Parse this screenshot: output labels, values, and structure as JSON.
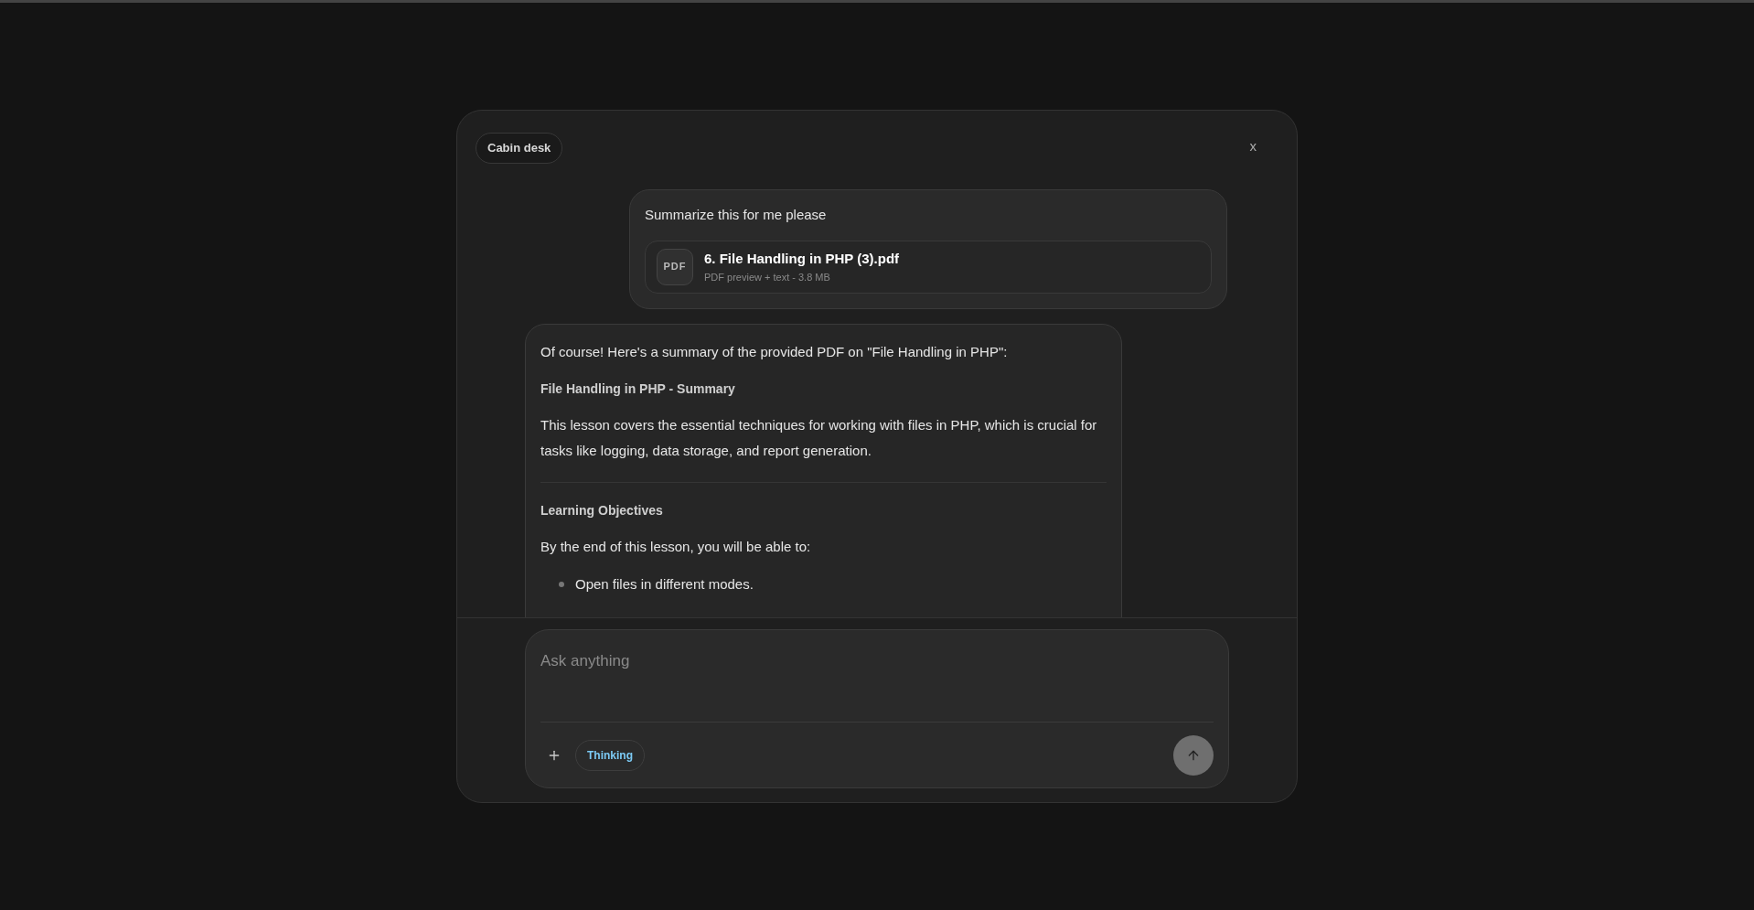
{
  "dialog": {
    "title_chip": "Cabin desk",
    "close": "x"
  },
  "messages": [
    {
      "kind": "user",
      "text": "Summarize this for me please",
      "attachment": {
        "badge": "PDF",
        "name": "6. File Handling in PHP (3).pdf",
        "meta": "PDF preview + text - 3.8 MB"
      }
    },
    {
      "kind": "assistant",
      "blocks": [
        {
          "kind": "paragraph",
          "text": "Of course! Here's a summary of the provided PDF on \"File Handling in PHP\":"
        },
        {
          "kind": "heading",
          "text": "File Handling in PHP - Summary"
        },
        {
          "kind": "paragraph",
          "text": "This lesson covers the essential techniques for working with files in PHP, which is crucial for tasks like logging, data storage, and report generation."
        },
        {
          "kind": "rule"
        },
        {
          "kind": "heading",
          "text": "Learning Objectives"
        },
        {
          "kind": "paragraph",
          "text": "By the end of this lesson, you will be able to:"
        },
        {
          "kind": "bullets",
          "items": [
            "Open files in different modes."
          ]
        }
      ]
    }
  ],
  "composer": {
    "placeholder": "Ask anything",
    "mode_chip": {
      "label": "Thinking",
      "selected": true
    }
  }
}
